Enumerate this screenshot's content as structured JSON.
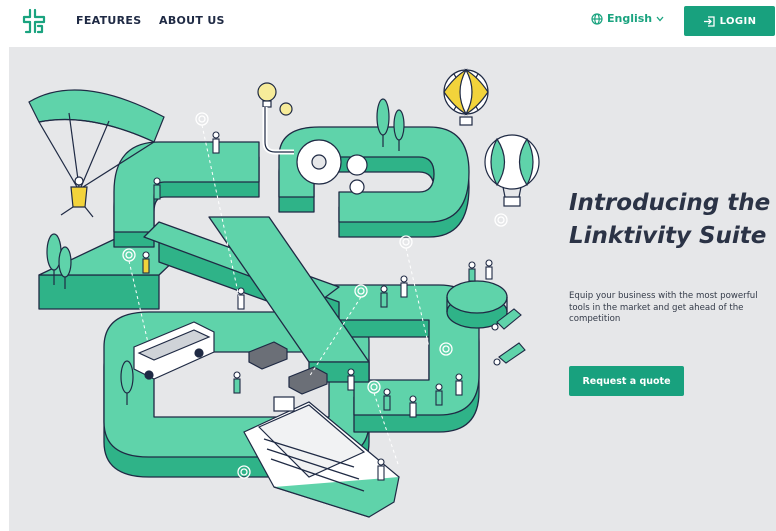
{
  "nav": {
    "features": "FEATURES",
    "about": "ABOUT US",
    "language": "English",
    "login": "LOGIN"
  },
  "hero": {
    "title": "Introducing the Linktivity Suite",
    "description": "Equip your business with the most powerful tools in the market and get ahead of the competition",
    "cta": "Request a quote"
  },
  "icons": {
    "logo": "linktivity-logo",
    "language": "globe-icon",
    "language_toggle": "chevron-down-icon",
    "login": "login-icon"
  },
  "colors": {
    "brand": "#18a17e",
    "text_dark": "#1f2a44",
    "hero_bg": "#e6e7e9",
    "mint": "#5fd3aa",
    "mint_dark": "#2fb388"
  }
}
